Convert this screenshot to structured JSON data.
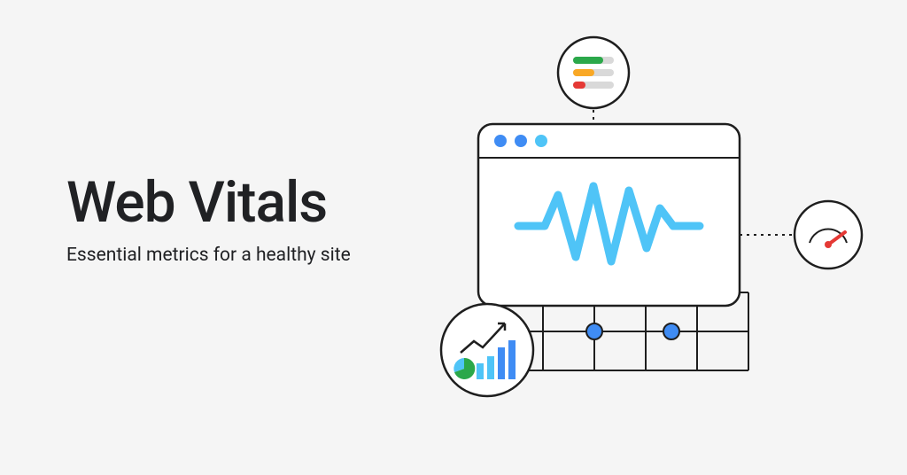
{
  "hero": {
    "title": "Web Vitals",
    "subtitle": "Essential metrics for a healthy site"
  },
  "colors": {
    "blue": "#3F8CF4",
    "lightblue": "#4FC4F7",
    "green": "#2BA84A",
    "orange": "#F9A825",
    "red": "#E53935",
    "grey": "#D9D9D9",
    "stroke": "#1E1E1E"
  }
}
